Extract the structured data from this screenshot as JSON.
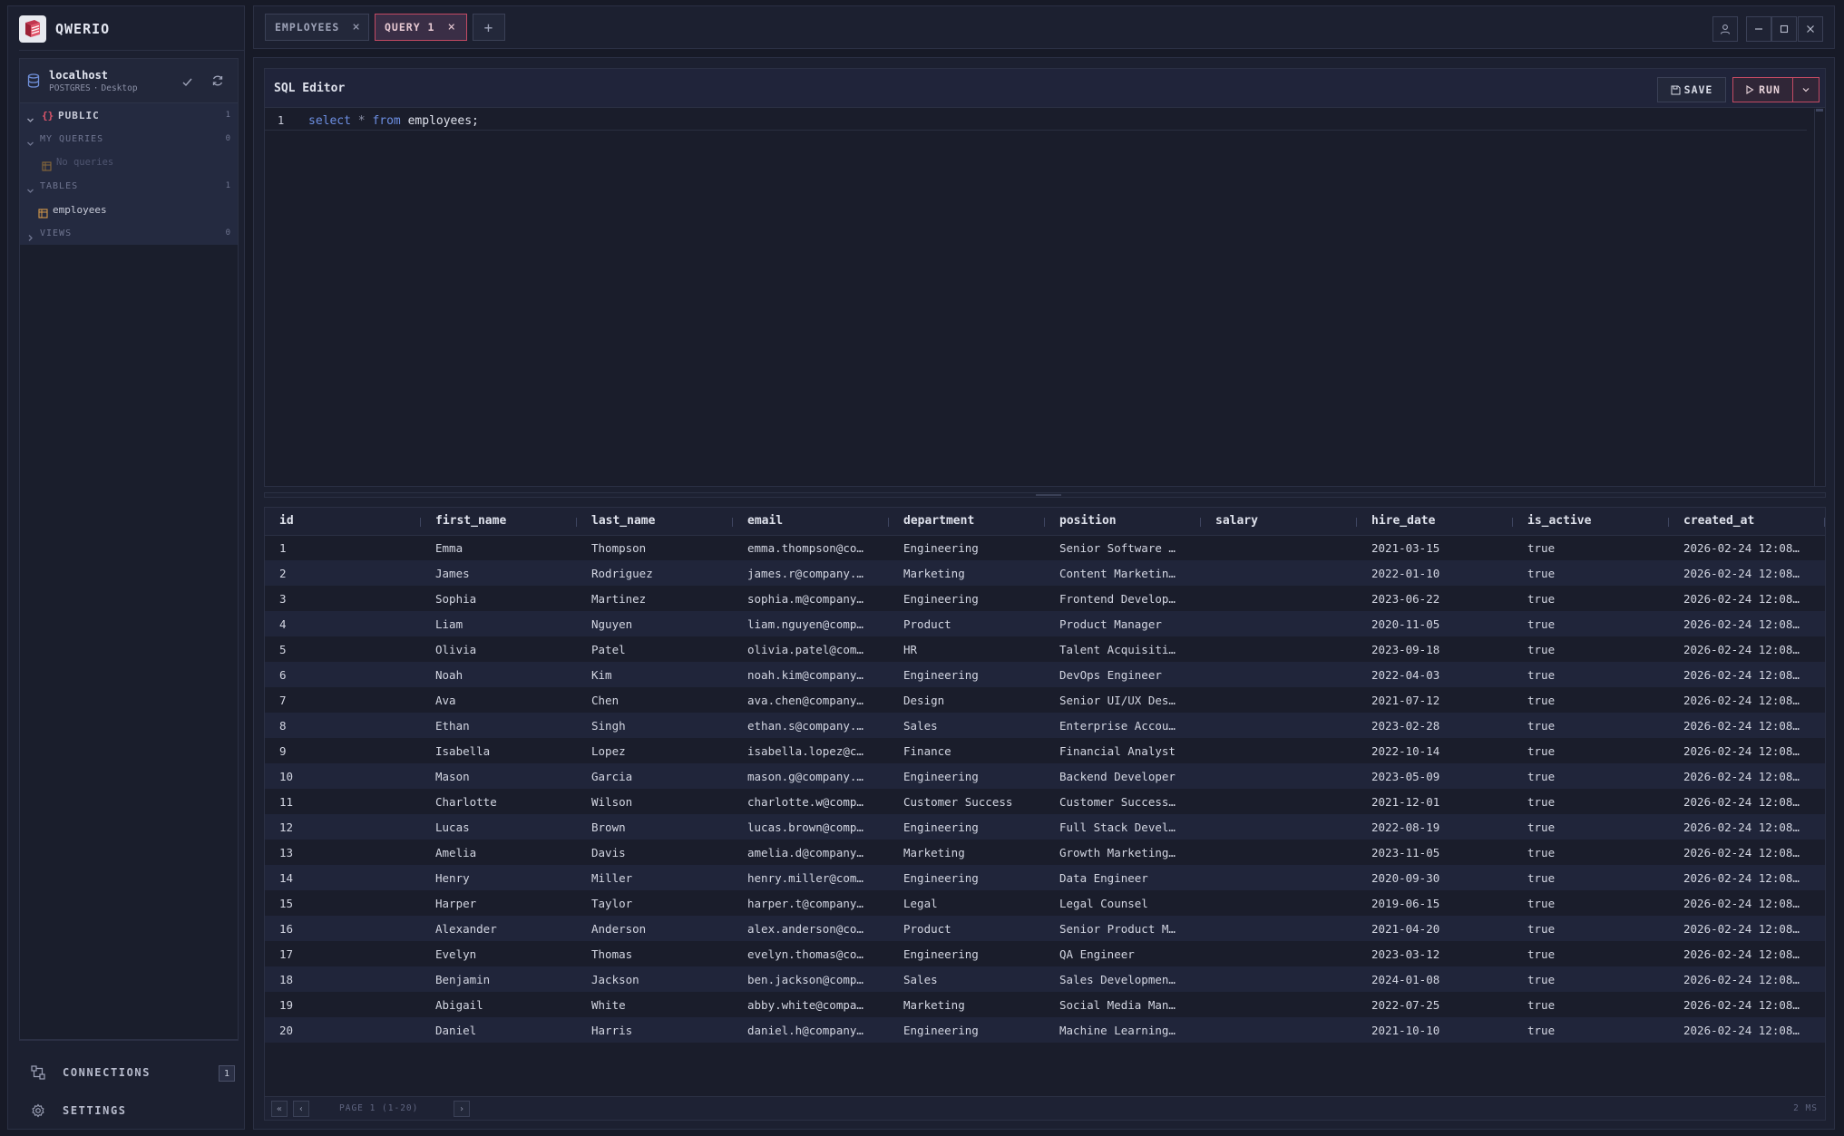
{
  "app": {
    "name": "QWERIO"
  },
  "connection": {
    "name": "localhost",
    "engine": "POSTGRES",
    "separator": "·",
    "mode": "Desktop"
  },
  "explorer": {
    "schema": {
      "braces": "{}",
      "name": "PUBLIC",
      "count": "1"
    },
    "my_queries": {
      "label": "MY QUERIES",
      "count": "0",
      "empty_text": "No queries"
    },
    "tables": {
      "label": "TABLES",
      "count": "1",
      "items": [
        "employees"
      ]
    },
    "views": {
      "label": "VIEWS",
      "count": "0"
    }
  },
  "nav": {
    "connections": {
      "label": "CONNECTIONS",
      "badge": "1"
    },
    "settings": {
      "label": "SETTINGS"
    }
  },
  "tabs": [
    {
      "label": "EMPLOYEES",
      "active": false
    },
    {
      "label": "QUERY 1",
      "active": true
    }
  ],
  "tab_add_label": "+",
  "editor": {
    "title": "SQL Editor",
    "save_label": "SAVE",
    "run_label": "RUN",
    "line_number": "1",
    "code": {
      "kw1": "select",
      "op": " * ",
      "kw2": "from",
      "rest": " employees;"
    }
  },
  "results": {
    "columns": [
      "id",
      "first_name",
      "last_name",
      "email",
      "department",
      "position",
      "salary",
      "hire_date",
      "is_active",
      "created_at"
    ],
    "rows": [
      [
        "1",
        "Emma",
        "Thompson",
        "emma.thompson@co…",
        "Engineering",
        "Senior Software …",
        "",
        "2021-03-15",
        "true",
        "2026-02-24 12:08…"
      ],
      [
        "2",
        "James",
        "Rodriguez",
        "james.r@company.…",
        "Marketing",
        "Content Marketin…",
        "",
        "2022-01-10",
        "true",
        "2026-02-24 12:08…"
      ],
      [
        "3",
        "Sophia",
        "Martinez",
        "sophia.m@company…",
        "Engineering",
        "Frontend Develop…",
        "",
        "2023-06-22",
        "true",
        "2026-02-24 12:08…"
      ],
      [
        "4",
        "Liam",
        "Nguyen",
        "liam.nguyen@comp…",
        "Product",
        "Product Manager",
        "",
        "2020-11-05",
        "true",
        "2026-02-24 12:08…"
      ],
      [
        "5",
        "Olivia",
        "Patel",
        "olivia.patel@com…",
        "HR",
        "Talent Acquisiti…",
        "",
        "2023-09-18",
        "true",
        "2026-02-24 12:08…"
      ],
      [
        "6",
        "Noah",
        "Kim",
        "noah.kim@company…",
        "Engineering",
        "DevOps Engineer",
        "",
        "2022-04-03",
        "true",
        "2026-02-24 12:08…"
      ],
      [
        "7",
        "Ava",
        "Chen",
        "ava.chen@company…",
        "Design",
        "Senior UI/UX Des…",
        "",
        "2021-07-12",
        "true",
        "2026-02-24 12:08…"
      ],
      [
        "8",
        "Ethan",
        "Singh",
        "ethan.s@company.…",
        "Sales",
        "Enterprise Accou…",
        "",
        "2023-02-28",
        "true",
        "2026-02-24 12:08…"
      ],
      [
        "9",
        "Isabella",
        "Lopez",
        "isabella.lopez@c…",
        "Finance",
        "Financial Analyst",
        "",
        "2022-10-14",
        "true",
        "2026-02-24 12:08…"
      ],
      [
        "10",
        "Mason",
        "Garcia",
        "mason.g@company.…",
        "Engineering",
        "Backend Developer",
        "",
        "2023-05-09",
        "true",
        "2026-02-24 12:08…"
      ],
      [
        "11",
        "Charlotte",
        "Wilson",
        "charlotte.w@comp…",
        "Customer Success",
        "Customer Success…",
        "",
        "2021-12-01",
        "true",
        "2026-02-24 12:08…"
      ],
      [
        "12",
        "Lucas",
        "Brown",
        "lucas.brown@comp…",
        "Engineering",
        "Full Stack Devel…",
        "",
        "2022-08-19",
        "true",
        "2026-02-24 12:08…"
      ],
      [
        "13",
        "Amelia",
        "Davis",
        "amelia.d@company…",
        "Marketing",
        "Growth Marketing…",
        "",
        "2023-11-05",
        "true",
        "2026-02-24 12:08…"
      ],
      [
        "14",
        "Henry",
        "Miller",
        "henry.miller@com…",
        "Engineering",
        "Data Engineer",
        "",
        "2020-09-30",
        "true",
        "2026-02-24 12:08…"
      ],
      [
        "15",
        "Harper",
        "Taylor",
        "harper.t@company…",
        "Legal",
        "Legal Counsel",
        "",
        "2019-06-15",
        "true",
        "2026-02-24 12:08…"
      ],
      [
        "16",
        "Alexander",
        "Anderson",
        "alex.anderson@co…",
        "Product",
        "Senior Product M…",
        "",
        "2021-04-20",
        "true",
        "2026-02-24 12:08…"
      ],
      [
        "17",
        "Evelyn",
        "Thomas",
        "evelyn.thomas@co…",
        "Engineering",
        "QA Engineer",
        "",
        "2023-03-12",
        "true",
        "2026-02-24 12:08…"
      ],
      [
        "18",
        "Benjamin",
        "Jackson",
        "ben.jackson@comp…",
        "Sales",
        "Sales Developmen…",
        "",
        "2024-01-08",
        "true",
        "2026-02-24 12:08…"
      ],
      [
        "19",
        "Abigail",
        "White",
        "abby.white@compa…",
        "Marketing",
        "Social Media Man…",
        "",
        "2022-07-25",
        "true",
        "2026-02-24 12:08…"
      ],
      [
        "20",
        "Daniel",
        "Harris",
        "daniel.h@company…",
        "Engineering",
        "Machine Learning…",
        "",
        "2021-10-10",
        "true",
        "2026-02-24 12:08…"
      ]
    ]
  },
  "pager": {
    "first_label": "«",
    "prev_label": "‹",
    "next_label": "›",
    "page_text": "PAGE 1 (1-20)",
    "time_text": "2 MS"
  },
  "colors": {
    "accent": "#c24a63",
    "background": "#171a27",
    "panel": "#1c2030"
  }
}
